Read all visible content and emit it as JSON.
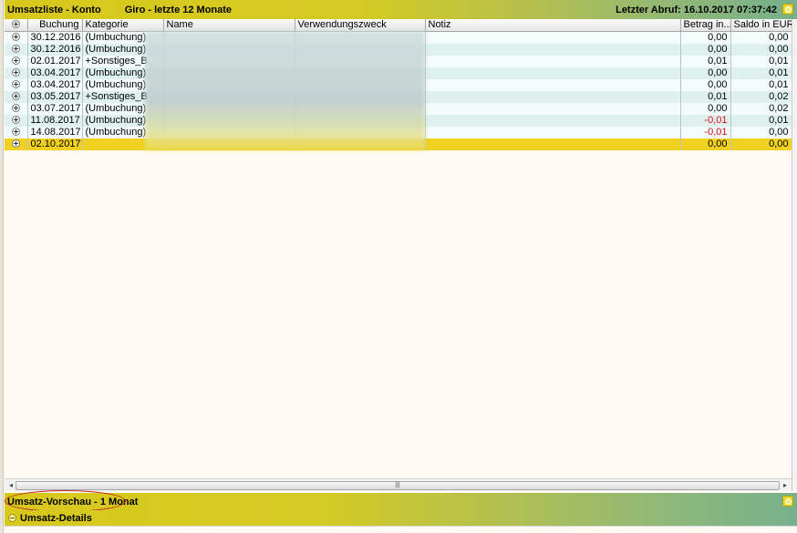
{
  "header": {
    "title_left": "Umsatzliste - Konto",
    "title_account": "Giro - letzte 12 Monate",
    "last_fetch": "Letzter Abruf: 16.10.2017 07:37:42"
  },
  "table": {
    "columns": [
      "Buchung",
      "Kategorie",
      "Name",
      "Verwendungszweck",
      "Notiz",
      "Betrag in...",
      "Saldo in EUR"
    ],
    "rows": [
      {
        "buchung": "30.12.2016",
        "kategorie": "(Umbuchung)",
        "betrag": "0,00",
        "saldo": "0,00"
      },
      {
        "buchung": "30.12.2016",
        "kategorie": "(Umbuchung)",
        "betrag": "0,00",
        "saldo": "0,00"
      },
      {
        "buchung": "02.01.2017",
        "kategorie": "+Sonstiges_B",
        "betrag": "0,01",
        "saldo": "0,01"
      },
      {
        "buchung": "03.04.2017",
        "kategorie": "(Umbuchung)",
        "betrag": "0,00",
        "saldo": "0,01"
      },
      {
        "buchung": "03.04.2017",
        "kategorie": "(Umbuchung)",
        "betrag": "0,00",
        "saldo": "0,01"
      },
      {
        "buchung": "03.05.2017",
        "kategorie": "+Sonstiges_B",
        "betrag": "0,01",
        "saldo": "0,02"
      },
      {
        "buchung": "03.07.2017",
        "kategorie": "(Umbuchung)",
        "betrag": "0,00",
        "saldo": "0,02"
      },
      {
        "buchung": "11.08.2017",
        "kategorie": "(Umbuchung)",
        "betrag": "-0,01",
        "saldo": "0,01"
      },
      {
        "buchung": "14.08.2017",
        "kategorie": "(Umbuchung)",
        "betrag": "-0,01",
        "saldo": "0,00"
      },
      {
        "buchung": "02.10.2017",
        "kategorie": "",
        "betrag": "0,00",
        "saldo": "0,00"
      }
    ]
  },
  "preview": {
    "label": "Umsatz-Vorschau - 1 Monat"
  },
  "details": {
    "label": "Umsatz-Details"
  },
  "colors": {
    "accent_yellow": "#d8c81c",
    "accent_green": "#76b08c",
    "selected_row": "#f0d020",
    "negative": "#d01010"
  },
  "icons": {
    "settings": "gear-icon",
    "expand_row": "plus-circle-icon",
    "collapse_panel": "minus-circle-icon"
  }
}
